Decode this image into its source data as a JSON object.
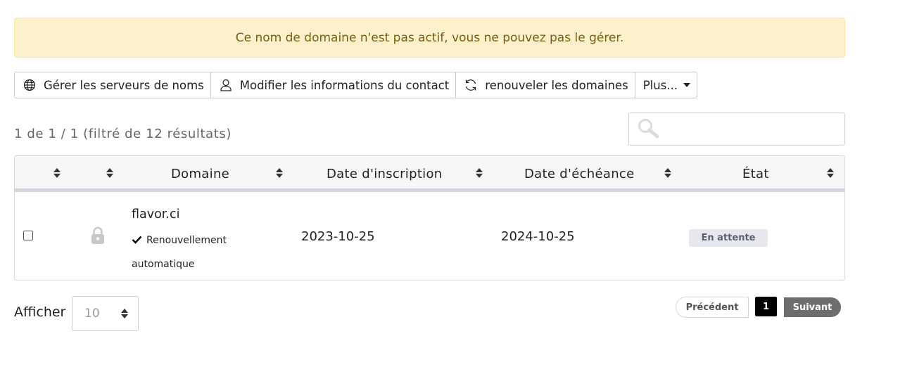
{
  "alert": {
    "message": "Ce nom de domaine n'est pas actif, vous ne pouvez pas le gérer."
  },
  "toolbar": {
    "buttons": [
      {
        "label": "Gérer les serveurs de noms",
        "icon": "globe-icon"
      },
      {
        "label": "Modifier les informations du contact",
        "icon": "user-icon"
      },
      {
        "label": "renouveler les domaines",
        "icon": "refresh-icon"
      },
      {
        "label": "Plus...",
        "icon": "caret-down-icon"
      }
    ]
  },
  "summary": "1 de 1 / 1 (filtré de 12 résultats)",
  "search": {
    "placeholder": "",
    "icon": "search-icon"
  },
  "table": {
    "columns": [
      "",
      "",
      "Domaine",
      "Date d'inscription",
      "Date d'échéance",
      "État"
    ],
    "rows": [
      {
        "domain": "flavor.ci",
        "auto_renew": "Renouvellement automatique",
        "registration_date": "2023-10-25",
        "expiry_date": "2024-10-25",
        "status": "En attente",
        "locked": true
      }
    ]
  },
  "pagination": {
    "show_label": "Afficher",
    "page_size": "10",
    "previous": "Précédent",
    "current_page": "1",
    "next": "Suivant"
  },
  "colors": {
    "alert_bg": "#fdf1cb",
    "alert_text": "#7a5c16",
    "badge_bg": "#e6e8ee",
    "next_button_bg": "#6d6d6d"
  }
}
